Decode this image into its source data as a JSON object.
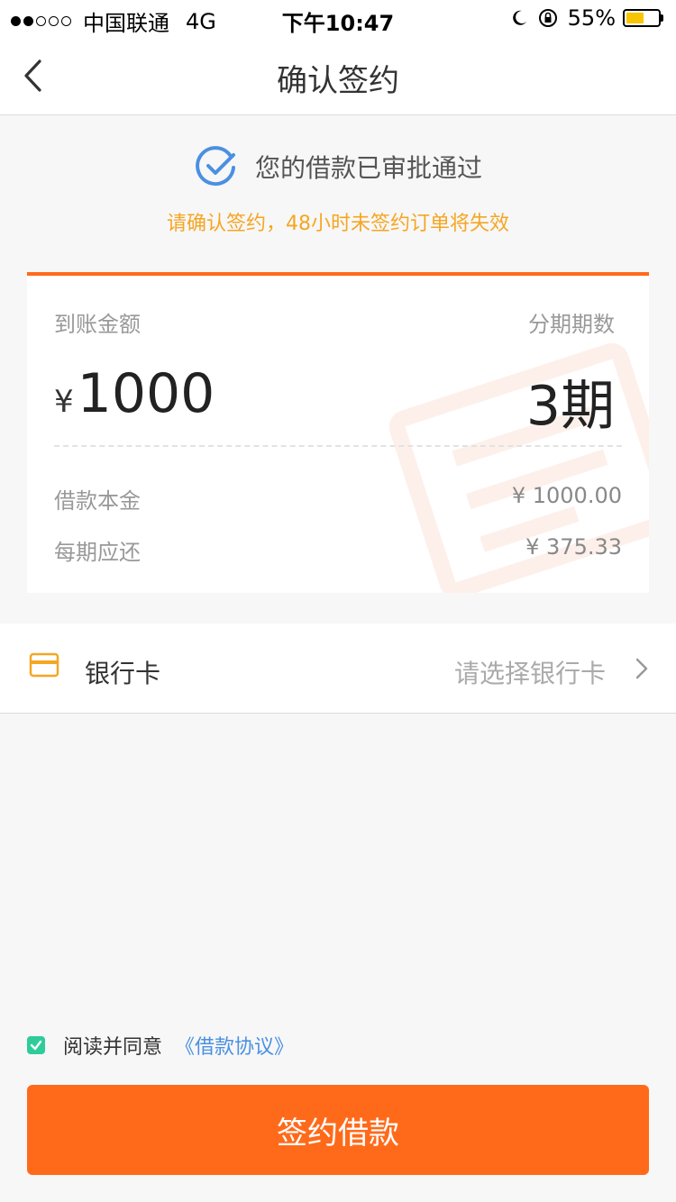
{
  "status_bar": {
    "carrier": "中国联通",
    "network": "4G",
    "time": "下午10:47",
    "battery": "55%",
    "battery_level": 0.55,
    "signal_bars_filled": 2,
    "signal_bars_total": 5
  },
  "nav": {
    "title": "确认签约",
    "back_icon": "chevron-left-icon"
  },
  "approval": {
    "icon": "check-circle-icon",
    "message": "您的借款已审批通过",
    "notice": "请确认签约，48小时未签约订单将失效"
  },
  "loan": {
    "amount_label": "到账金额",
    "currency": "¥",
    "amount": "1000",
    "term_label": "分期期数",
    "term": "3期",
    "principal_label": "借款本金",
    "principal": "¥ 1000.00",
    "installment_label": "每期应还",
    "installment": "¥ 375.33"
  },
  "bank": {
    "icon": "credit-card-icon",
    "label": "银行卡",
    "placeholder": "请选择银行卡",
    "chevron_icon": "chevron-right-icon"
  },
  "agreement": {
    "checked": true,
    "text": "阅读并同意",
    "link": "《借款协议》"
  },
  "submit": {
    "label": "签约借款"
  },
  "colors": {
    "accent": "#ff6a1a",
    "notice": "#f5a623",
    "link": "#4a90e2",
    "check": "#2ecc9a",
    "approval_icon": "#4a90e2"
  }
}
